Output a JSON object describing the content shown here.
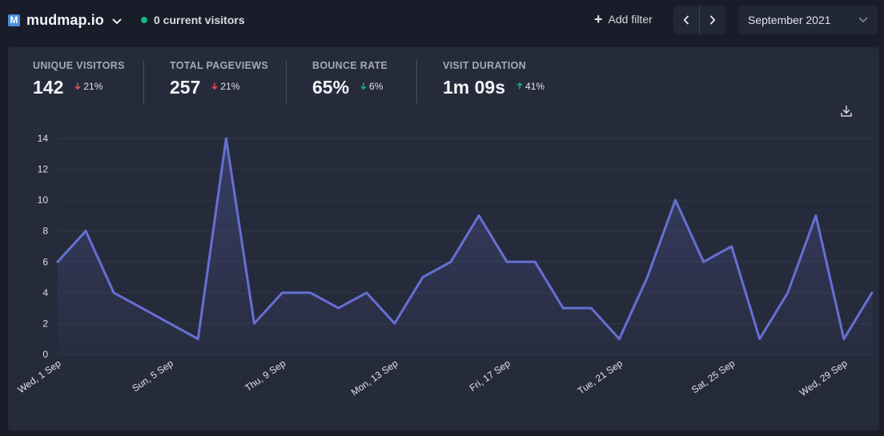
{
  "header": {
    "favicon_letter": "M",
    "site_name": "mudmap.io",
    "current_visitors": "0 current visitors",
    "add_filter_label": "Add filter",
    "period_label": "September 2021"
  },
  "metrics": [
    {
      "label": "UNIQUE VISITORS",
      "value": "142",
      "change": "21%",
      "direction": "down"
    },
    {
      "label": "TOTAL PAGEVIEWS",
      "value": "257",
      "change": "21%",
      "direction": "down"
    },
    {
      "label": "BOUNCE RATE",
      "value": "65%",
      "change": "6%",
      "direction": "down"
    },
    {
      "label": "VISIT DURATION",
      "value": "1m 09s",
      "change": "41%",
      "direction": "up"
    }
  ],
  "colors": {
    "line": "#6570d4",
    "fill": "#2d3352",
    "grid": "#323748",
    "tick_text": "#dde0e8",
    "down_red": "#f05252",
    "down_green": "#10b981",
    "up_green": "#10b981"
  },
  "chart_data": {
    "type": "area",
    "x": [
      "Wed, 1 Sep",
      "Thu, 2 Sep",
      "Fri, 3 Sep",
      "Sat, 4 Sep",
      "Sun, 5 Sep",
      "Mon, 6 Sep",
      "Tue, 7 Sep",
      "Wed, 8 Sep",
      "Thu, 9 Sep",
      "Fri, 10 Sep",
      "Sat, 11 Sep",
      "Sun, 12 Sep",
      "Mon, 13 Sep",
      "Tue, 14 Sep",
      "Wed, 15 Sep",
      "Thu, 16 Sep",
      "Fri, 17 Sep",
      "Sat, 18 Sep",
      "Sun, 19 Sep",
      "Mon, 20 Sep",
      "Tue, 21 Sep",
      "Wed, 22 Sep",
      "Thu, 23 Sep",
      "Fri, 24 Sep",
      "Sat, 25 Sep",
      "Sun, 26 Sep",
      "Mon, 27 Sep",
      "Tue, 28 Sep",
      "Wed, 29 Sep",
      "Thu, 30 Sep"
    ],
    "x_tick_labels": [
      "Wed, 1 Sep",
      "Sun, 5 Sep",
      "Thu, 9 Sep",
      "Mon, 13 Sep",
      "Fri, 17 Sep",
      "Tue, 21 Sep",
      "Sat, 25 Sep",
      "Wed, 29 Sep"
    ],
    "series": [
      {
        "values": [
          6,
          8,
          4,
          3,
          2,
          1,
          14,
          2,
          4,
          4,
          3,
          4,
          2,
          5,
          6,
          9,
          6,
          6,
          3,
          3,
          1,
          5,
          10,
          6,
          7,
          1,
          4,
          9,
          1,
          4
        ]
      }
    ],
    "y_ticks": [
      0,
      2,
      4,
      6,
      8,
      10,
      12,
      14
    ],
    "ylim": [
      0,
      14
    ],
    "grid": true
  }
}
